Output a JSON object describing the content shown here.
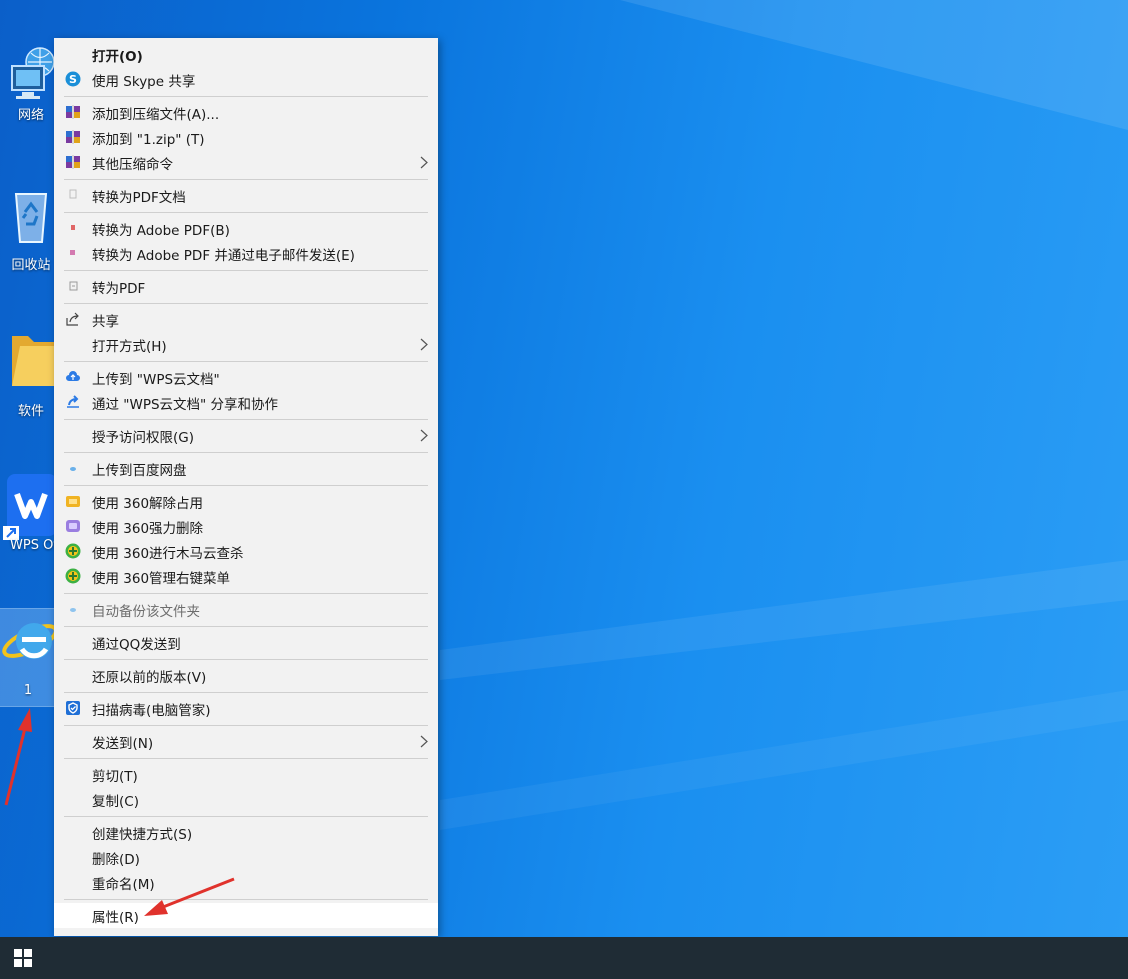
{
  "desktop": {
    "icons": [
      {
        "label": "网络"
      },
      {
        "label": "回收站"
      },
      {
        "label": "软件"
      },
      {
        "label": "WPS Of"
      },
      {
        "label": "1"
      }
    ]
  },
  "menu": {
    "items": [
      {
        "label": "打开(O)"
      },
      {
        "label": "使用 Skype 共享"
      },
      {
        "label": "添加到压缩文件(A)..."
      },
      {
        "label": "添加到 \"1.zip\" (T)"
      },
      {
        "label": "其他压缩命令"
      },
      {
        "label": "转换为PDF文档"
      },
      {
        "label": "转换为 Adobe PDF(B)"
      },
      {
        "label": "转换为 Adobe PDF 并通过电子邮件发送(E)"
      },
      {
        "label": "转为PDF"
      },
      {
        "label": "共享"
      },
      {
        "label": "打开方式(H)"
      },
      {
        "label": "上传到 \"WPS云文档\""
      },
      {
        "label": "通过 \"WPS云文档\" 分享和协作"
      },
      {
        "label": "授予访问权限(G)"
      },
      {
        "label": "上传到百度网盘"
      },
      {
        "label": "使用 360解除占用"
      },
      {
        "label": "使用 360强力删除"
      },
      {
        "label": "使用 360进行木马云查杀"
      },
      {
        "label": "使用 360管理右键菜单"
      },
      {
        "label": "自动备份该文件夹"
      },
      {
        "label": "通过QQ发送到"
      },
      {
        "label": "还原以前的版本(V)"
      },
      {
        "label": "扫描病毒(电脑管家)"
      },
      {
        "label": "发送到(N)"
      },
      {
        "label": "剪切(T)"
      },
      {
        "label": "复制(C)"
      },
      {
        "label": "创建快捷方式(S)"
      },
      {
        "label": "删除(D)"
      },
      {
        "label": "重命名(M)"
      },
      {
        "label": "属性(R)"
      }
    ]
  },
  "colors": {
    "menu_bg": "#f2f2f2",
    "taskbar": "#1f2c35",
    "annotation_arrow": "#e0322c"
  }
}
